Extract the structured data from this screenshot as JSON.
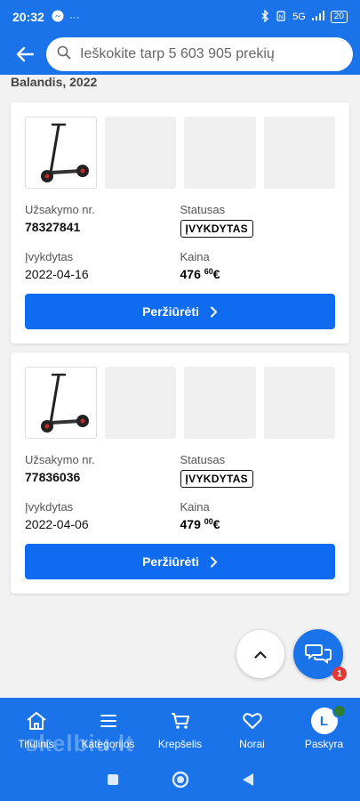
{
  "status_bar": {
    "time": "20:32",
    "left_icons": [
      "messenger-icon",
      "more-dots-icon"
    ],
    "network": "5G",
    "battery": "20"
  },
  "header": {
    "search_placeholder": "Ieškokite tarp 5 603 905 prekių"
  },
  "month_label": "Balandis, 2022",
  "orders": [
    {
      "order_no_label": "Užsakymo nr.",
      "order_no": "78327841",
      "status_label": "Statusas",
      "status": "ĮVYKDYTAS",
      "fulfilled_label": "Įvykdytas",
      "fulfilled_date": "2022-04-16",
      "price_label": "Kaina",
      "price_main": "476",
      "price_cents": "60",
      "currency": "€",
      "button_label": "Peržiūrėti"
    },
    {
      "order_no_label": "Užsakymo nr.",
      "order_no": "77836036",
      "status_label": "Statusas",
      "status": "ĮVYKDYTAS",
      "fulfilled_label": "Įvykdytas",
      "fulfilled_date": "2022-04-06",
      "price_label": "Kaina",
      "price_main": "479",
      "price_cents": "00",
      "currency": "€",
      "button_label": "Peržiūrėti"
    }
  ],
  "chat_badge": "1",
  "bottom_nav": {
    "items": [
      {
        "label": "Titulinis",
        "icon": "home-icon"
      },
      {
        "label": "Kategorijos",
        "icon": "menu-icon"
      },
      {
        "label": "Krepšelis",
        "icon": "cart-icon"
      },
      {
        "label": "Norai",
        "icon": "heart-icon"
      },
      {
        "label": "Paskyra",
        "icon": "avatar-icon"
      }
    ],
    "avatar_letter": "L"
  },
  "watermark": "skelbiu.lt",
  "colors": {
    "primary": "#1a73e8",
    "button": "#0f6cf0",
    "badge_red": "#e53935"
  }
}
